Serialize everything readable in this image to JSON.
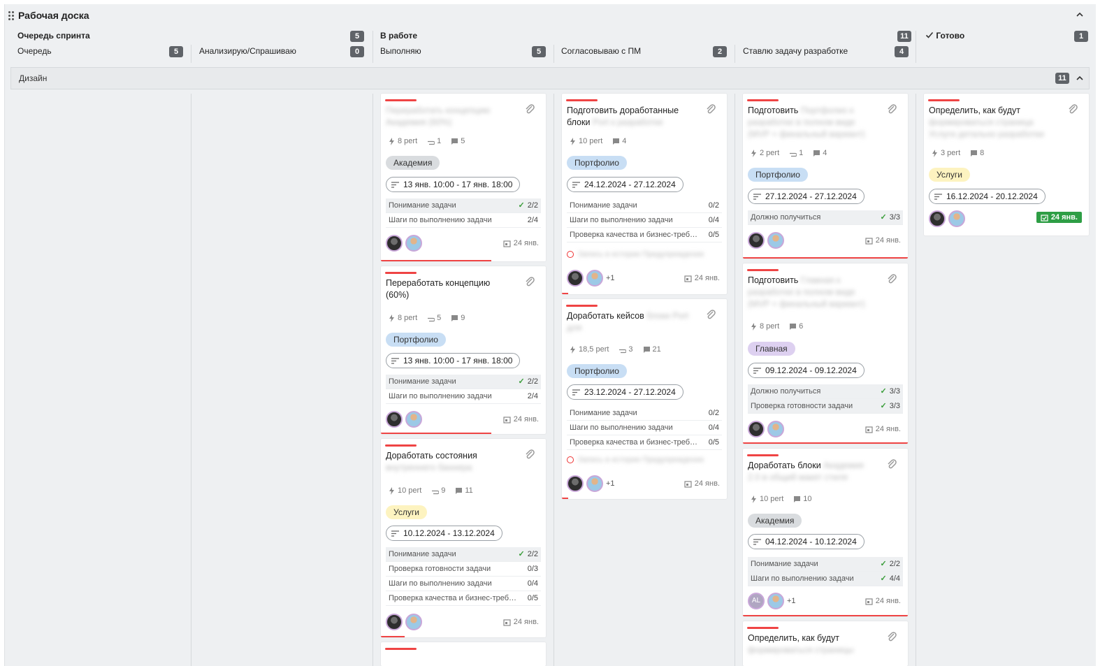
{
  "board": {
    "title": "Рабочая доска"
  },
  "groups": [
    {
      "name": "Очередь спринта",
      "count": "5"
    },
    {
      "name": "В работе",
      "count": "11"
    },
    {
      "name": "Готово",
      "count": "1"
    }
  ],
  "statuses": [
    {
      "name": "Очередь",
      "count": "5"
    },
    {
      "name": "Анализирую/Спрашиваю",
      "count": "0"
    },
    {
      "name": "Выполняю",
      "count": "5"
    },
    {
      "name": "Согласовываю с ПМ",
      "count": "2"
    },
    {
      "name": "Ставлю задачу разработке",
      "count": "4"
    }
  ],
  "swimlane": {
    "title": "Дизайн",
    "count": "11"
  },
  "cards": {
    "c1": {
      "title": "",
      "title_blur": "Переработать концепцию Академия (60%)",
      "pert": "8 pert",
      "attach": "1",
      "comments": "5",
      "tag": "Академия",
      "date": "13 янв. 10:00 - 17 янв. 18:00",
      "checks": [
        {
          "label": "Понимание задачи",
          "cnt": "2/2"
        },
        {
          "label": "Шаги по выполнению задачи",
          "cnt": "2/4"
        }
      ],
      "due": "24 янв."
    },
    "c2": {
      "title": "Переработать концепцию (60%)",
      "pert": "8 pert",
      "attach": "5",
      "comments": "9",
      "tag": "Портфолио",
      "date": "13 янв. 10:00 - 17 янв. 18:00",
      "checks": [
        {
          "label": "Понимание задачи",
          "cnt": "2/2"
        },
        {
          "label": "Шаги по выполнению задачи",
          "cnt": "2/4"
        }
      ],
      "due": "24 янв."
    },
    "c3": {
      "title": "Доработать состояния",
      "title_blur": "внутреннего баннера",
      "pert": "10 pert",
      "attach": "9",
      "comments": "11",
      "tag": "Услуги",
      "date": "10.12.2024 - 13.12.2024",
      "checks": [
        {
          "label": "Понимание задачи",
          "cnt": "2/2"
        },
        {
          "label": "Проверка готовности задачи",
          "cnt": "0/3"
        },
        {
          "label": "Шаги по выполнению задачи",
          "cnt": "0/4"
        },
        {
          "label": "Проверка качества и бизнес-треб…",
          "cnt": "0/5"
        }
      ],
      "due": "24 янв."
    },
    "c4": {
      "title": "Подготовить доработанные блоки",
      "title_blur": "Port к разработке",
      "pert": "10 pert",
      "comments": "4",
      "tag": "Портфолио",
      "date": "24.12.2024 - 27.12.2024",
      "checks": [
        {
          "label": "Понимание задачи",
          "cnt": "0/2"
        },
        {
          "label": "Шаги по выполнению задачи",
          "cnt": "0/4"
        },
        {
          "label": "Проверка качества и бизнес-треб…",
          "cnt": "0/5"
        }
      ],
      "err": "Запись в истории Предупреждение",
      "more": "+1",
      "due": "24 янв."
    },
    "c5": {
      "title": "Доработать кейсов",
      "title_blur": "блоки Port для",
      "pert": "18,5 pert",
      "attach": "3",
      "comments": "21",
      "tag": "Портфолио",
      "date": "23.12.2024 - 27.12.2024",
      "checks": [
        {
          "label": "Понимание задачи",
          "cnt": "0/2"
        },
        {
          "label": "Шаги по выполнению задачи",
          "cnt": "0/4"
        },
        {
          "label": "Проверка качества и бизнес-треб…",
          "cnt": "0/5"
        }
      ],
      "err": "Запись в истории Предупреждение",
      "more": "+1",
      "due": "24 янв."
    },
    "c6": {
      "title": "Подготовить",
      "title_blur": "Портфолио к разработке в полном виде (MVP + финальный вариант)",
      "pert": "2 pert",
      "attach": "1",
      "comments": "4",
      "tag": "Портфолио",
      "date": "27.12.2024 - 27.12.2024",
      "checks": [
        {
          "label": "Должно получиться",
          "cnt": "3/3"
        }
      ],
      "due": "24 янв."
    },
    "c7": {
      "title": "Подготовить",
      "title_blur": "Главная к разработке в полном виде (MVP + финальный вариант)",
      "pert": "8 pert",
      "comments": "6",
      "tag": "Главная",
      "date": "09.12.2024 - 09.12.2024",
      "checks": [
        {
          "label": "Должно получиться",
          "cnt": "3/3"
        },
        {
          "label": "Проверка готовности задачи",
          "cnt": "3/3"
        }
      ],
      "due": "24 янв."
    },
    "c8": {
      "title": "Доработать блоки",
      "title_blur": "Академия 2.0 в общий макет стиля",
      "pert": "10 pert",
      "comments": "10",
      "tag": "Академия",
      "date": "04.12.2024 - 10.12.2024",
      "checks": [
        {
          "label": "Понимание задачи",
          "cnt": "2/2"
        },
        {
          "label": "Шаги по выполнению задачи",
          "cnt": "4/4"
        }
      ],
      "avatar_initials": "AL",
      "more": "+1",
      "due": "24 янв."
    },
    "c9": {
      "title": "Определить, как будут",
      "title_blur": "формироваться страницы"
    },
    "c10": {
      "title": "Определить, как будут",
      "title_blur": "формироваться страница Услуги детально разработки",
      "pert": "3 pert",
      "comments": "8",
      "tag": "Услуги",
      "date": "16.12.2024 - 20.12.2024",
      "due": "24 янв."
    }
  },
  "colors": {
    "accent_red": "#ef4444",
    "done_green": "#2e9e45"
  }
}
